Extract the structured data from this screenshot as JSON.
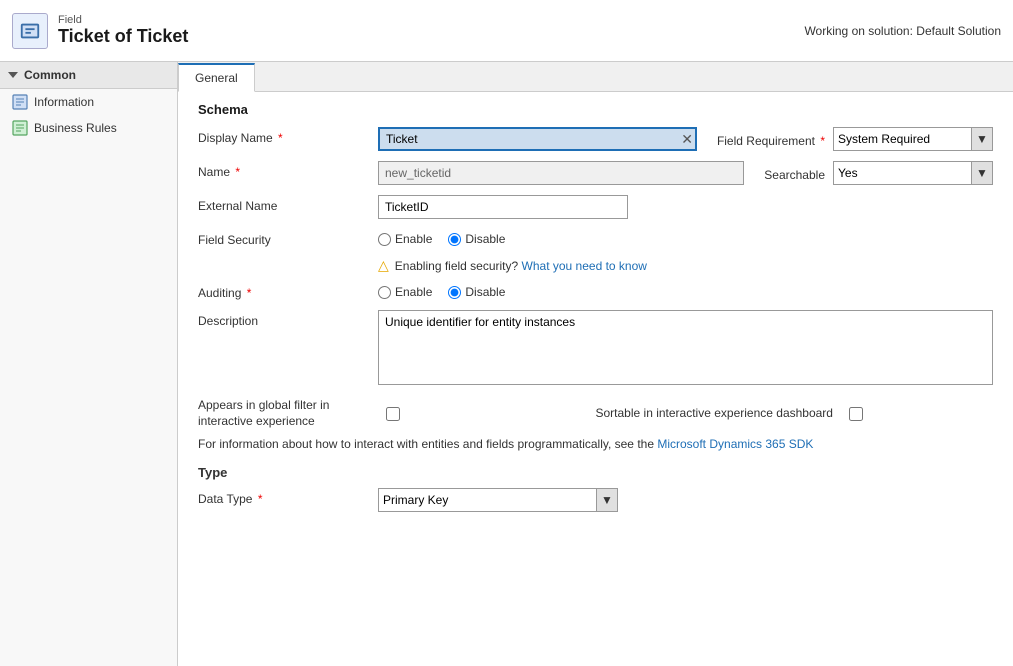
{
  "header": {
    "subtitle": "Field",
    "title": "Ticket of Ticket",
    "working_on": "Working on solution: Default Solution",
    "icon_label": "field-icon"
  },
  "sidebar": {
    "section_label": "Common",
    "items": [
      {
        "label": "Information",
        "icon": "info-icon"
      },
      {
        "label": "Business Rules",
        "icon": "rules-icon"
      }
    ]
  },
  "tabs": [
    {
      "label": "General",
      "active": true
    }
  ],
  "form": {
    "schema_title": "Schema",
    "display_name_label": "Display Name",
    "display_name_value": "Ticket",
    "display_name_required": true,
    "name_label": "Name",
    "name_value": "new_ticketid",
    "name_required": true,
    "external_name_label": "External Name",
    "external_name_value": "TicketID",
    "field_security_label": "Field Security",
    "field_security_enable": "Enable",
    "field_security_disable": "Disable",
    "field_security_selected": "disable",
    "warning_text": "Enabling field security?",
    "warning_link": "What you need to know",
    "auditing_label": "Auditing",
    "auditing_required": true,
    "auditing_enable": "Enable",
    "auditing_disable": "Disable",
    "auditing_selected": "disable",
    "description_label": "Description",
    "description_value": "Unique identifier for entity instances",
    "appears_in_filter_label": "Appears in global filter in interactive experience",
    "sortable_label": "Sortable in interactive experience dashboard",
    "info_text_prefix": "For information about how to interact with entities and fields programmatically, see the",
    "info_link": "Microsoft Dynamics 365 SDK",
    "info_text_suffix": "",
    "type_section_title": "Type",
    "data_type_label": "Data Type",
    "data_type_required": true,
    "data_type_value": "Primary Key",
    "field_requirement_label": "Field Requirement",
    "field_requirement_required": true,
    "field_requirement_value": "System Required",
    "searchable_label": "Searchable",
    "searchable_value": "Yes"
  }
}
